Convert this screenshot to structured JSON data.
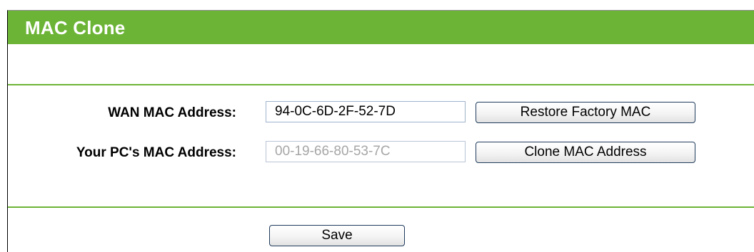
{
  "header": {
    "title": "MAC Clone"
  },
  "form": {
    "wan_mac": {
      "label": "WAN MAC Address:",
      "value": "94-0C-6D-2F-52-7D",
      "button_label": "Restore Factory MAC"
    },
    "pc_mac": {
      "label": "Your PC's MAC Address:",
      "value": "00-19-66-80-53-7C",
      "button_label": "Clone MAC Address"
    }
  },
  "footer": {
    "save_label": "Save"
  },
  "colors": {
    "accent": "#6cb436",
    "button_border": "#1f3b5c",
    "field_border": "#9fb3cc",
    "readonly_text": "#a6a6a6"
  }
}
